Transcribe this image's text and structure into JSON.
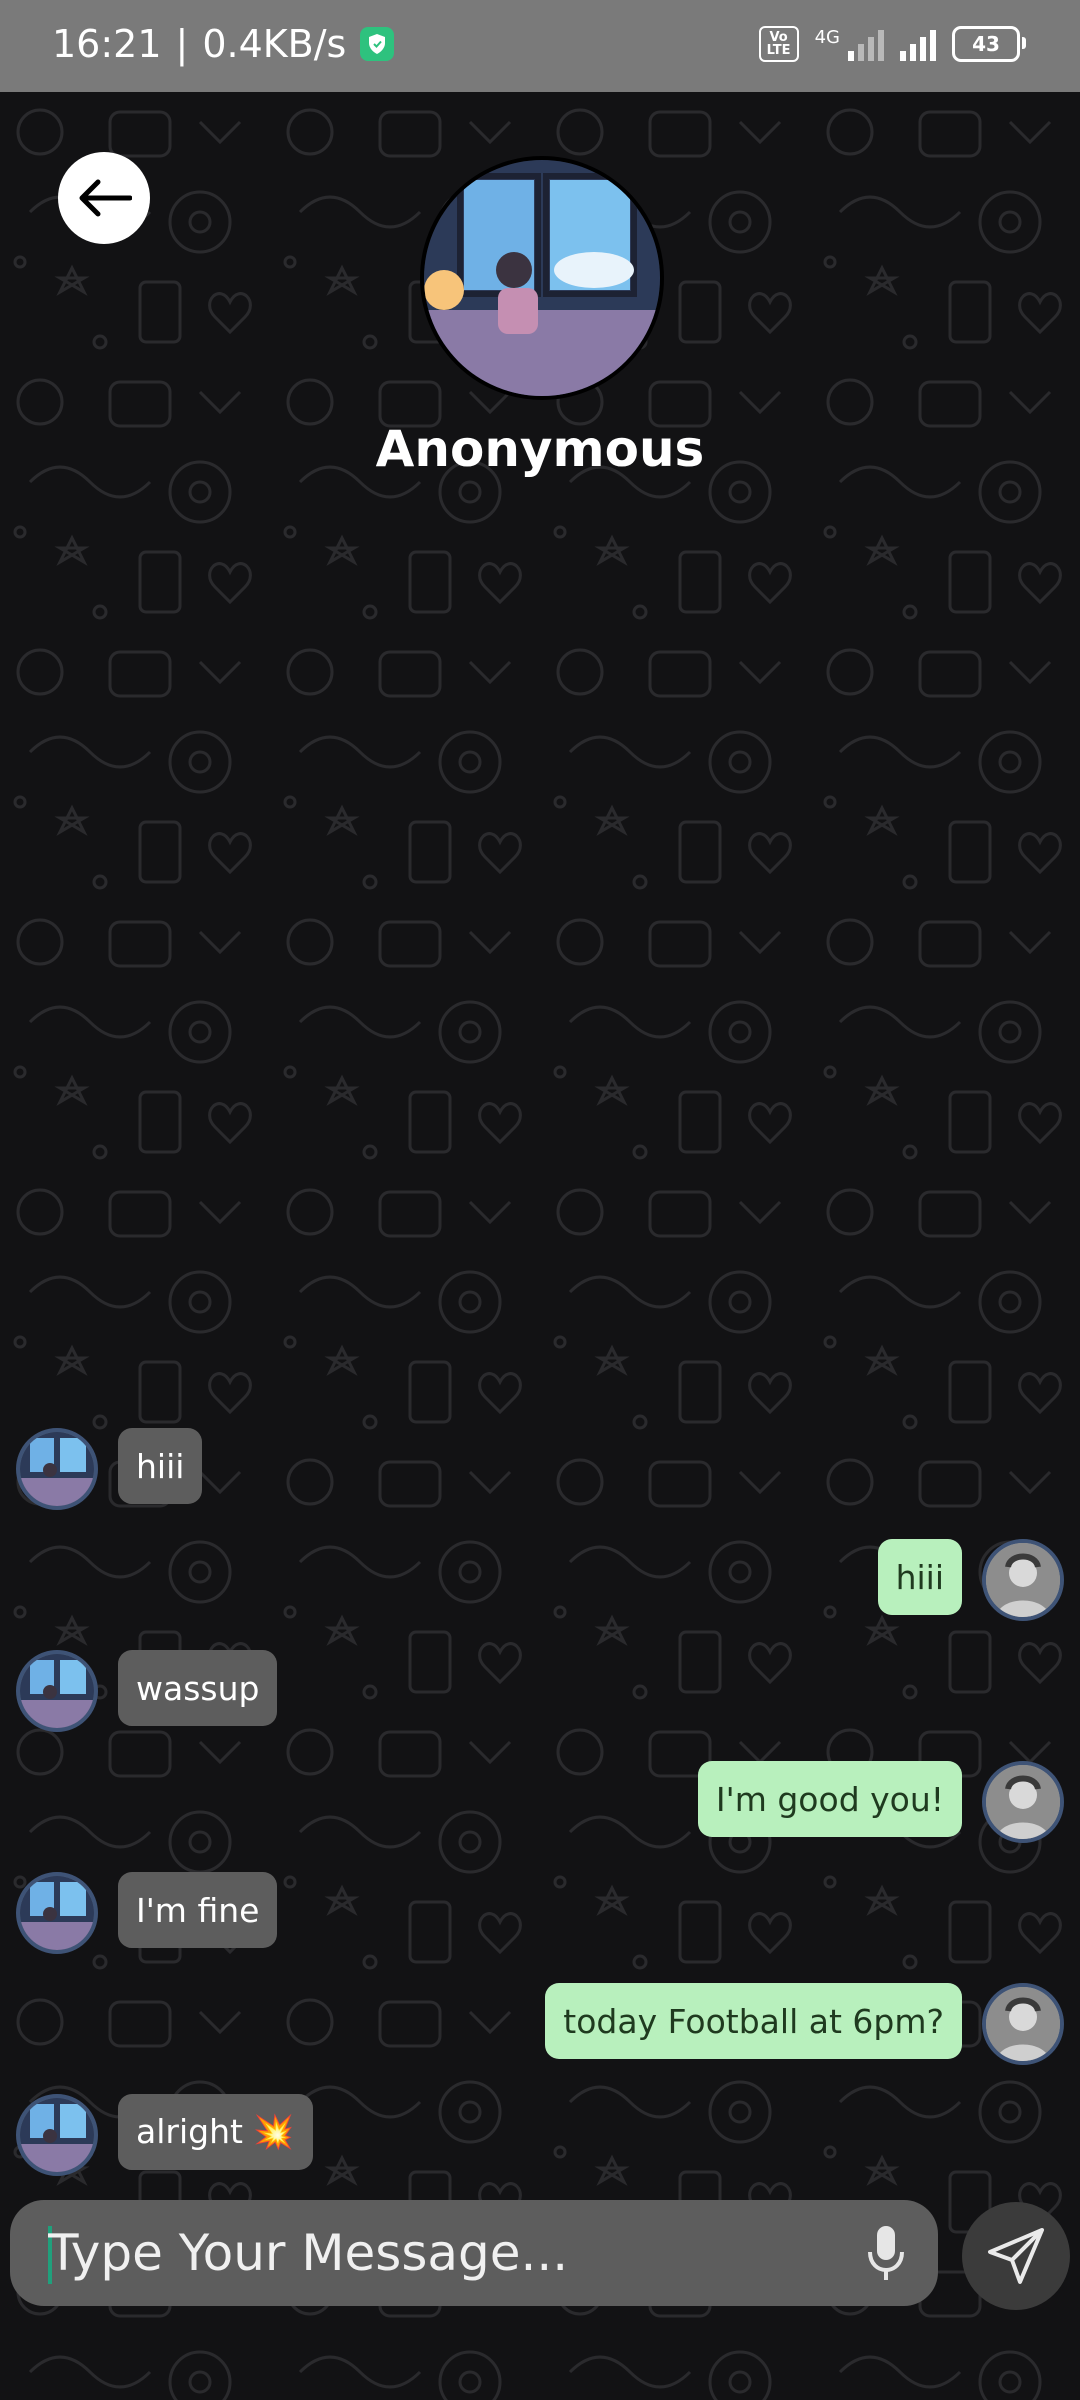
{
  "status_bar": {
    "time": "16:21",
    "separator": "|",
    "speed": "0.4KB/s",
    "network_label": "4G",
    "volte_top": "Vo",
    "volte_bottom": "LTE",
    "battery": "43"
  },
  "header": {
    "name": "Anonymous",
    "avatar_icon": "profile-photo"
  },
  "messages": [
    {
      "side": "in",
      "text": "hiii"
    },
    {
      "side": "out",
      "text": "hiii"
    },
    {
      "side": "in",
      "text": "wassup"
    },
    {
      "side": "out",
      "text": "I'm good you!"
    },
    {
      "side": "in",
      "text": "I'm fine"
    },
    {
      "side": "out",
      "text": "today Football at 6pm?"
    },
    {
      "side": "in",
      "text": "alright 💥"
    }
  ],
  "composer": {
    "placeholder": "Type Your Message..."
  },
  "colors": {
    "incoming_bubble": "#5d5d5d",
    "outgoing_bubble": "#b8f0bd",
    "status_bar": "#7a7a7a",
    "background": "#121214"
  }
}
